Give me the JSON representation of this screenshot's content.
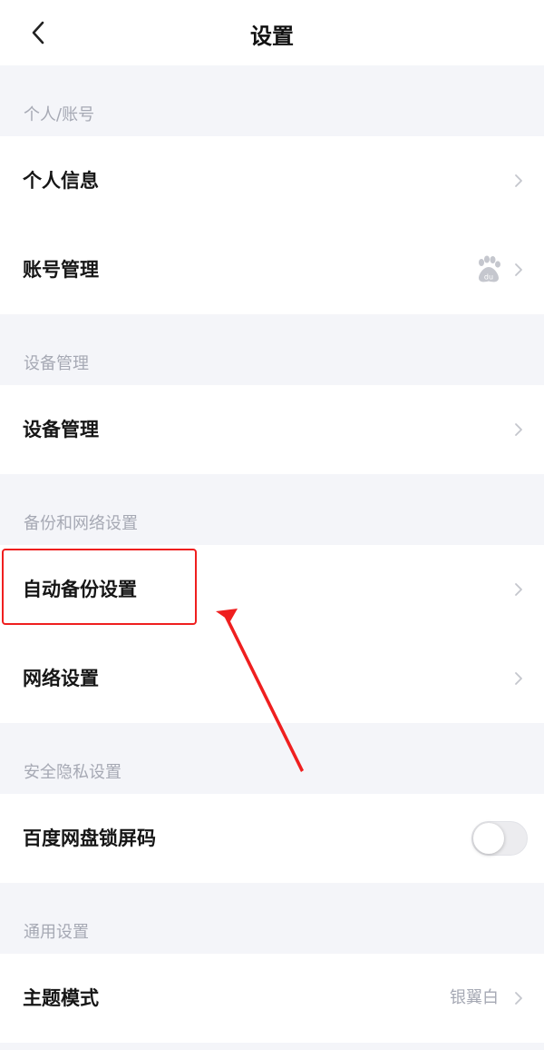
{
  "header": {
    "title": "设置"
  },
  "sections": [
    {
      "title": "个人/账号",
      "items": [
        {
          "label": "个人信息"
        },
        {
          "label": "账号管理"
        }
      ]
    },
    {
      "title": "设备管理",
      "items": [
        {
          "label": "设备管理"
        }
      ]
    },
    {
      "title": "备份和网络设置",
      "items": [
        {
          "label": "自动备份设置"
        },
        {
          "label": "网络设置"
        }
      ]
    },
    {
      "title": "安全隐私设置",
      "items": [
        {
          "label": "百度网盘锁屏码",
          "toggle_on": false
        }
      ]
    },
    {
      "title": "通用设置",
      "items": [
        {
          "label": "主题模式",
          "value": "银翼白"
        }
      ]
    }
  ],
  "icons": {
    "back": "chevron-left-icon",
    "chevron": "chevron-right-icon",
    "account_brand": "baidu-paw-icon"
  },
  "colors": {
    "background": "#f4f5f9",
    "card": "#ffffff",
    "section_text": "#a6a9b4",
    "annotation": "#ef1f1f"
  }
}
